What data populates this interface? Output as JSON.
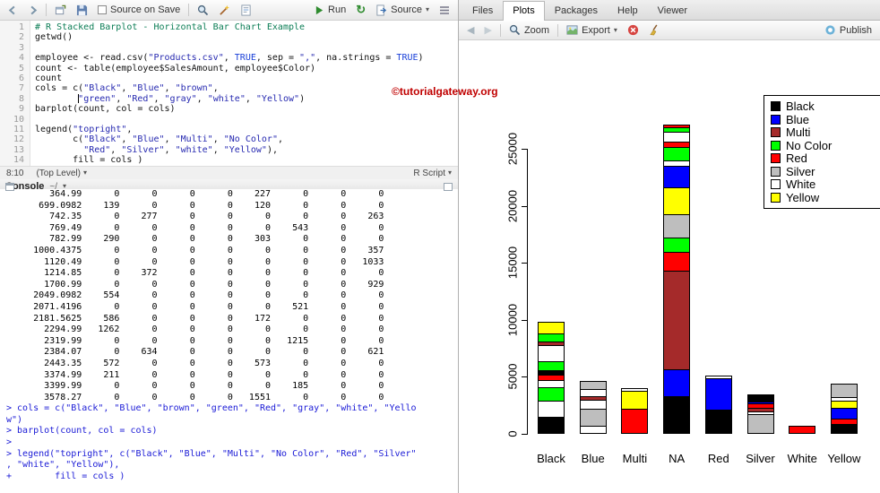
{
  "watermark": "©tutorialgateway.org",
  "icons": {
    "rerun-icon": "↻",
    "dropdown-caret-icon": "▾",
    "back-icon": "◀",
    "forward-icon": "▶"
  },
  "source_pane": {
    "toolbar": {
      "source_on_save": "Source on Save",
      "run": "Run",
      "source": "Source"
    },
    "code_lines": [
      "# R Stacked Barplot - Horizontal Bar Chart Example",
      "getwd()",
      "",
      "employee <- read.csv(\"Products.csv\", TRUE, sep = \",\", na.strings = TRUE)",
      "count <- table(employee$SalesAmount, employee$Color)",
      "count",
      "cols = c(\"Black\", \"Blue\", \"brown\",",
      "        \"green\", \"Red\", \"gray\", \"white\", \"Yellow\")",
      "barplot(count, col = cols)",
      "",
      "legend(\"topright\",",
      "       c(\"Black\", \"Blue\", \"Multi\", \"No Color\",",
      "         \"Red\", \"Silver\", \"white\", \"Yellow\"),",
      "       fill = cols )"
    ],
    "status": {
      "position": "8:10",
      "scope": "(Top Level)",
      "type": "R Script"
    }
  },
  "console_pane": {
    "title": "Console",
    "path": "~/",
    "lines": [
      {
        "type": "output",
        "text": "        364.99      0      0      0      0    227      0      0      0"
      },
      {
        "type": "output",
        "text": "      699.0982    139      0      0      0    120      0      0      0"
      },
      {
        "type": "output",
        "text": "        742.35      0    277      0      0      0      0      0    263"
      },
      {
        "type": "output",
        "text": "        769.49      0      0      0      0      0    543      0      0"
      },
      {
        "type": "output",
        "text": "        782.99    290      0      0      0    303      0      0      0"
      },
      {
        "type": "output",
        "text": "     1000.4375      0      0      0      0      0      0      0    357"
      },
      {
        "type": "output",
        "text": "       1120.49      0      0      0      0      0      0      0   1033"
      },
      {
        "type": "output",
        "text": "       1214.85      0    372      0      0      0      0      0      0"
      },
      {
        "type": "output",
        "text": "       1700.99      0      0      0      0      0      0      0    929"
      },
      {
        "type": "output",
        "text": "     2049.0982    554      0      0      0      0      0      0      0"
      },
      {
        "type": "output",
        "text": "     2071.4196      0      0      0      0      0    521      0      0"
      },
      {
        "type": "output",
        "text": "     2181.5625    586      0      0      0    172      0      0      0"
      },
      {
        "type": "output",
        "text": "       2294.99   1262      0      0      0      0      0      0      0"
      },
      {
        "type": "output",
        "text": "       2319.99      0      0      0      0      0   1215      0      0"
      },
      {
        "type": "output",
        "text": "       2384.07      0    634      0      0      0      0      0    621"
      },
      {
        "type": "output",
        "text": "       2443.35    572      0      0      0    573      0      0      0"
      },
      {
        "type": "output",
        "text": "       3374.99    211      0      0      0      0      0      0      0"
      },
      {
        "type": "output",
        "text": "       3399.99      0      0      0      0      0    185      0      0"
      },
      {
        "type": "output",
        "text": "       3578.27      0      0      0      0   1551      0      0      0"
      },
      {
        "type": "input",
        "text": "> cols = c(\"Black\", \"Blue\", \"brown\", \"green\", \"Red\", \"gray\", \"white\", \"Yello"
      },
      {
        "type": "input",
        "text": "w\")"
      },
      {
        "type": "input",
        "text": "> barplot(count, col = cols)"
      },
      {
        "type": "input",
        "text": "> "
      },
      {
        "type": "input",
        "text": "> legend(\"topright\", c(\"Black\", \"Blue\", \"Multi\", \"No Color\", \"Red\", \"Silver\""
      },
      {
        "type": "input",
        "text": ", \"white\", \"Yellow\"),"
      },
      {
        "type": "input",
        "text": "+        fill = cols )"
      }
    ]
  },
  "right_pane": {
    "tabs": [
      "Files",
      "Plots",
      "Packages",
      "Help",
      "Viewer"
    ],
    "active_tab": "Plots",
    "toolbar": {
      "zoom": "Zoom",
      "export": "Export",
      "publish": "Publish"
    }
  },
  "chart_data": {
    "type": "bar",
    "stacked": true,
    "title": "",
    "xlabel": "",
    "ylabel": "",
    "ylim": [
      0,
      27500
    ],
    "yticks": [
      0,
      5000,
      10000,
      15000,
      20000,
      25000
    ],
    "grid": false,
    "categories": [
      "Black",
      "Blue",
      "Multi",
      "NA",
      "Red",
      "Silver",
      "White",
      "Yellow"
    ],
    "totals_estimated": [
      9800,
      4670,
      4040,
      27140,
      5130,
      3500,
      700,
      4430
    ],
    "palette": {
      "black": "#000000",
      "blue": "#0000FF",
      "brown": "#A52A2A",
      "green": "#00FF00",
      "red": "#FF0000",
      "gray": "#BEBEBE",
      "white": "#FFFFFF",
      "yellow": "#FFFF00"
    },
    "bars": [
      {
        "category": "Black",
        "segments": [
          [
            "black",
            1500
          ],
          [
            "white",
            1400
          ],
          [
            "green",
            1200
          ],
          [
            "white",
            600
          ],
          [
            "red",
            500
          ],
          [
            "black",
            350
          ],
          [
            "green",
            800
          ],
          [
            "white",
            1450
          ],
          [
            "brown",
            300
          ],
          [
            "green",
            700
          ],
          [
            "yellow",
            1000
          ]
        ]
      },
      {
        "category": "Blue",
        "segments": [
          [
            "white",
            700
          ],
          [
            "gray",
            1500
          ],
          [
            "white",
            800
          ],
          [
            "brown",
            300
          ],
          [
            "white",
            600
          ],
          [
            "gray",
            770
          ]
        ]
      },
      {
        "category": "Multi",
        "segments": [
          [
            "red",
            2200
          ],
          [
            "yellow",
            1600
          ],
          [
            "white",
            240
          ]
        ]
      },
      {
        "category": "NA",
        "segments": [
          [
            "black",
            3300
          ],
          [
            "blue",
            2400
          ],
          [
            "brown",
            8600
          ],
          [
            "red",
            1700
          ],
          [
            "green",
            1200
          ],
          [
            "gray",
            2100
          ],
          [
            "yellow",
            2300
          ],
          [
            "blue",
            1900
          ],
          [
            "white",
            500
          ],
          [
            "green",
            1200
          ],
          [
            "red",
            400
          ],
          [
            "white",
            900
          ],
          [
            "green",
            400
          ],
          [
            "red",
            240
          ]
        ]
      },
      {
        "category": "Red",
        "segments": [
          [
            "black",
            2100
          ],
          [
            "blue",
            2800
          ],
          [
            "white",
            230
          ]
        ]
      },
      {
        "category": "Silver",
        "segments": [
          [
            "gray",
            1700
          ],
          [
            "white",
            300
          ],
          [
            "brown",
            300
          ],
          [
            "red",
            350
          ],
          [
            "blue",
            200
          ],
          [
            "black",
            650
          ]
        ]
      },
      {
        "category": "White",
        "segments": [
          [
            "red",
            700
          ]
        ]
      },
      {
        "category": "Yellow",
        "segments": [
          [
            "black",
            900
          ],
          [
            "red",
            450
          ],
          [
            "blue",
            950
          ],
          [
            "yellow",
            650
          ],
          [
            "white",
            280
          ],
          [
            "gray",
            1200
          ]
        ]
      }
    ],
    "legend": {
      "position": "topright",
      "entries": [
        {
          "label": "Black",
          "color": "#000000"
        },
        {
          "label": "Blue",
          "color": "#0000FF"
        },
        {
          "label": "Multi",
          "color": "#A52A2A"
        },
        {
          "label": "No Color",
          "color": "#00FF00"
        },
        {
          "label": "Red",
          "color": "#FF0000"
        },
        {
          "label": "Silver",
          "color": "#BEBEBE"
        },
        {
          "label": "White",
          "color": "#FFFFFF"
        },
        {
          "label": "Yellow",
          "color": "#FFFF00"
        }
      ]
    }
  }
}
